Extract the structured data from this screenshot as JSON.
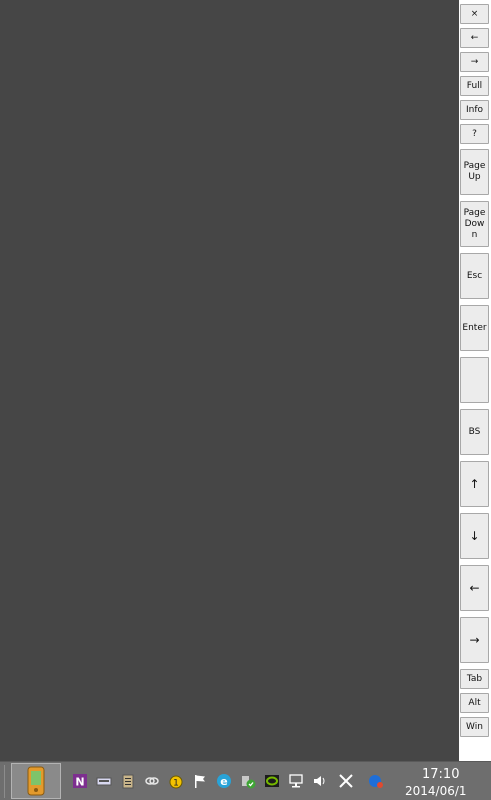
{
  "side_buttons": [
    "×",
    "←",
    "→",
    "Full",
    "Info",
    "?",
    "PageUp",
    "PageDown",
    "Esc",
    "Enter",
    "",
    "BS",
    "↑",
    "↓",
    "←",
    "→",
    "Tab",
    "Alt",
    "Win"
  ],
  "icons": {
    "start": "device-phone-icon",
    "tray": [
      "onenote-icon",
      "tablet-keyboard-icon",
      "clipboard-icon",
      "link-icon",
      "alert-shield-icon",
      "action-center-flag-icon",
      "edge-ie-icon",
      "shield-check-icon",
      "nvidia-icon",
      "network-icon",
      "volume-icon",
      "close-x-icon",
      "onedrive-blue-icon"
    ]
  },
  "clock": {
    "time": "17:10",
    "date": "2014/06/1"
  },
  "colors": {
    "desktop": "#464646",
    "panel": "#ffffff",
    "taskbar": "#6e6e6e",
    "button": "#ececec"
  }
}
